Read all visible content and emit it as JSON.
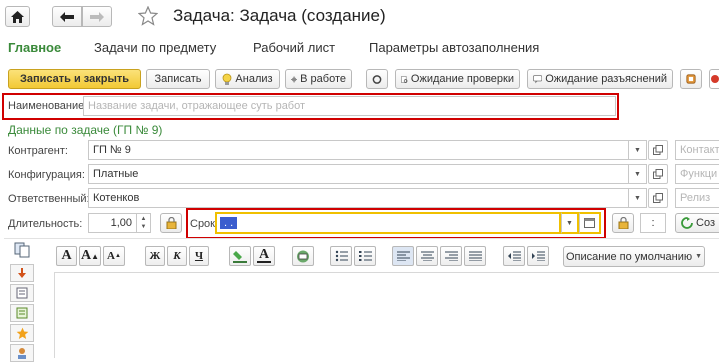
{
  "window": {
    "title": "Задача: Задача (создание)"
  },
  "nav": {
    "home_icon": "home-icon",
    "back_icon": "arrow-left-icon",
    "forward_icon": "arrow-right-icon",
    "star_icon": "star-icon"
  },
  "tabs": [
    {
      "label": "Главное",
      "active": true
    },
    {
      "label": "Задачи по предмету"
    },
    {
      "label": "Рабочий лист"
    },
    {
      "label": "Параметры автозаполнения"
    }
  ],
  "toolbar": {
    "save_close": "Записать и закрыть",
    "save": "Записать",
    "analysis": "Анализ",
    "in_work": "В работе",
    "wait_check": "Ожидание проверки",
    "wait_clarify": "Ожидание разъяснений"
  },
  "form": {
    "name_label": "Наименование:",
    "name_placeholder": "Название задачи, отражающее суть работ",
    "section_title": "Данные по задаче (ГП № 9)",
    "counterparty_label": "Контрагент:",
    "counterparty_value": "ГП № 9",
    "contact_placeholder": "Контакт",
    "config_label": "Конфигурация:",
    "config_value": "Платные",
    "function_placeholder": "Функци",
    "responsible_label": "Ответственный:",
    "responsible_value": "Котенков",
    "release_placeholder": "Релиз",
    "duration_label": "Длительность:",
    "duration_value": "1,00",
    "deadline_label": "Срок:",
    "deadline_value": " .  .    ",
    "time_value": ":",
    "create_button": "Соз"
  },
  "editor": {
    "font_a": "A",
    "bold": "Ж",
    "italic": "К",
    "underline": "Ч",
    "description_default": "Описание по умолчанию"
  },
  "colors": {
    "accent_green": "#3a8a3a",
    "save_yellow": "#f7d343",
    "highlight_red": "#d00000",
    "focus_yellow": "#f0c000",
    "date_selection": "#3b5dce"
  }
}
